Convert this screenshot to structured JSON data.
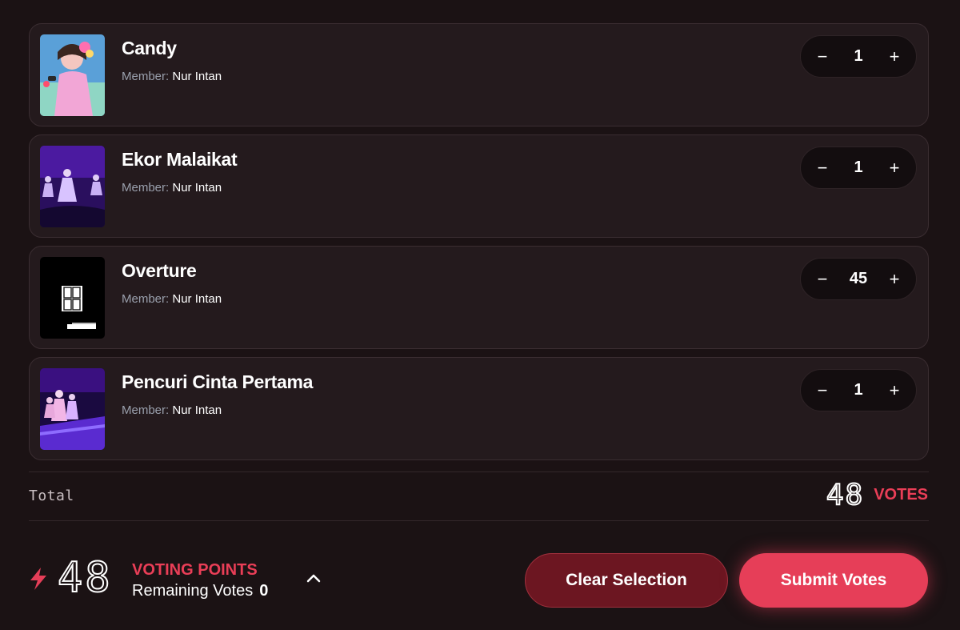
{
  "songs": [
    {
      "title": "Candy",
      "member_label": "Member:",
      "member": "Nur Intan",
      "votes": "1",
      "thumb": "stage-performer-pink"
    },
    {
      "title": "Ekor Malaikat",
      "member_label": "Member:",
      "member": "Nur Intan",
      "votes": "1",
      "thumb": "stage-purple"
    },
    {
      "title": "Overture",
      "member_label": "Member:",
      "member": "Nur Intan",
      "votes": "45",
      "thumb": "jkt48-logo-black"
    },
    {
      "title": "Pencuri Cinta Pertama",
      "member_label": "Member:",
      "member": "Nur Intan",
      "votes": "1",
      "thumb": "stage-group-purple"
    }
  ],
  "stepper": {
    "minus": "−",
    "plus": "+"
  },
  "total": {
    "label": "Total",
    "value": "48",
    "unit": "VOTES"
  },
  "points": {
    "value": "48",
    "title": "VOTING POINTS",
    "remaining_label": "Remaining Votes",
    "remaining_value": "0"
  },
  "actions": {
    "clear": "Clear Selection",
    "submit": "Submit Votes"
  },
  "colors": {
    "accent": "#e63e58",
    "background": "#1b1214",
    "card": "#241a1d"
  }
}
